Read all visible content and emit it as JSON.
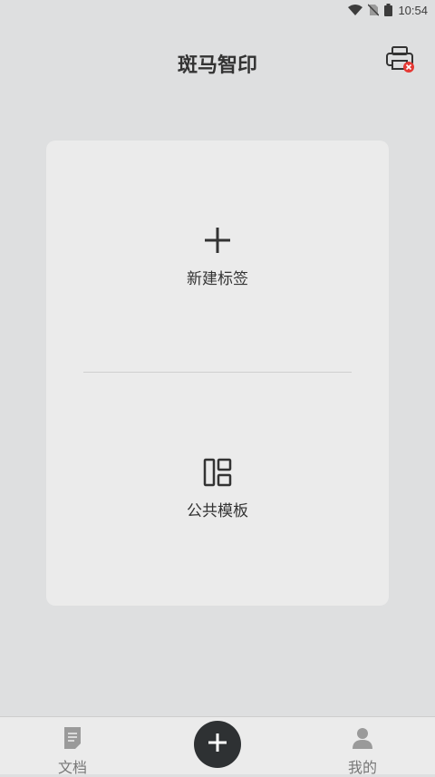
{
  "status_bar": {
    "time": "10:54",
    "icons": [
      "wifi-icon",
      "no-sim-icon",
      "battery-icon"
    ]
  },
  "header": {
    "title": "斑马智印",
    "printer_icon": "printer-disconnected-icon"
  },
  "card": {
    "new_label": {
      "label": "新建标签",
      "icon": "plus-icon"
    },
    "template": {
      "label": "公共模板",
      "icon": "template-layout-icon"
    }
  },
  "bottom_nav": {
    "docs": {
      "label": "文档",
      "icon": "document-icon"
    },
    "add": {
      "icon": "plus-icon"
    },
    "mine": {
      "label": "我的",
      "icon": "user-icon"
    }
  },
  "colors": {
    "background": "#dedfe0",
    "card": "#ebebeb",
    "fab": "#2e3133",
    "alert": "#e53935"
  }
}
